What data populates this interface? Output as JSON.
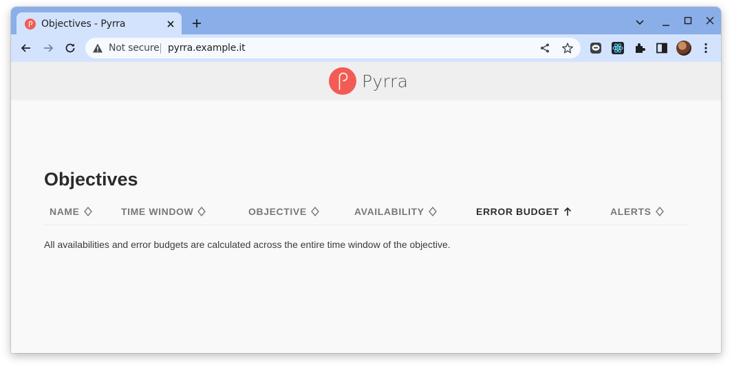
{
  "browser": {
    "tab": {
      "title": "Objectives - Pyrra",
      "favicon": "pyrra-favicon-icon"
    },
    "address_bar": {
      "security_label": "Not secure",
      "url": "pyrra.example.it"
    },
    "colors": {
      "tabstrip": "#8aaee8",
      "toolbar": "#d3e3fd"
    }
  },
  "site": {
    "logo_text": "Pyrra",
    "brand_color": "#f25c54"
  },
  "main": {
    "title": "Objectives",
    "table": {
      "columns": [
        {
          "label": "NAME",
          "sort": "none"
        },
        {
          "label": "TIME WINDOW",
          "sort": "none"
        },
        {
          "label": "OBJECTIVE",
          "sort": "none"
        },
        {
          "label": "AVAILABILITY",
          "sort": "none"
        },
        {
          "label": "ERROR BUDGET",
          "sort": "ascending"
        },
        {
          "label": "ALERTS",
          "sort": "none"
        }
      ],
      "rows": []
    },
    "note": "All availabilities and error budgets are calculated across the entire time window of the objective."
  }
}
